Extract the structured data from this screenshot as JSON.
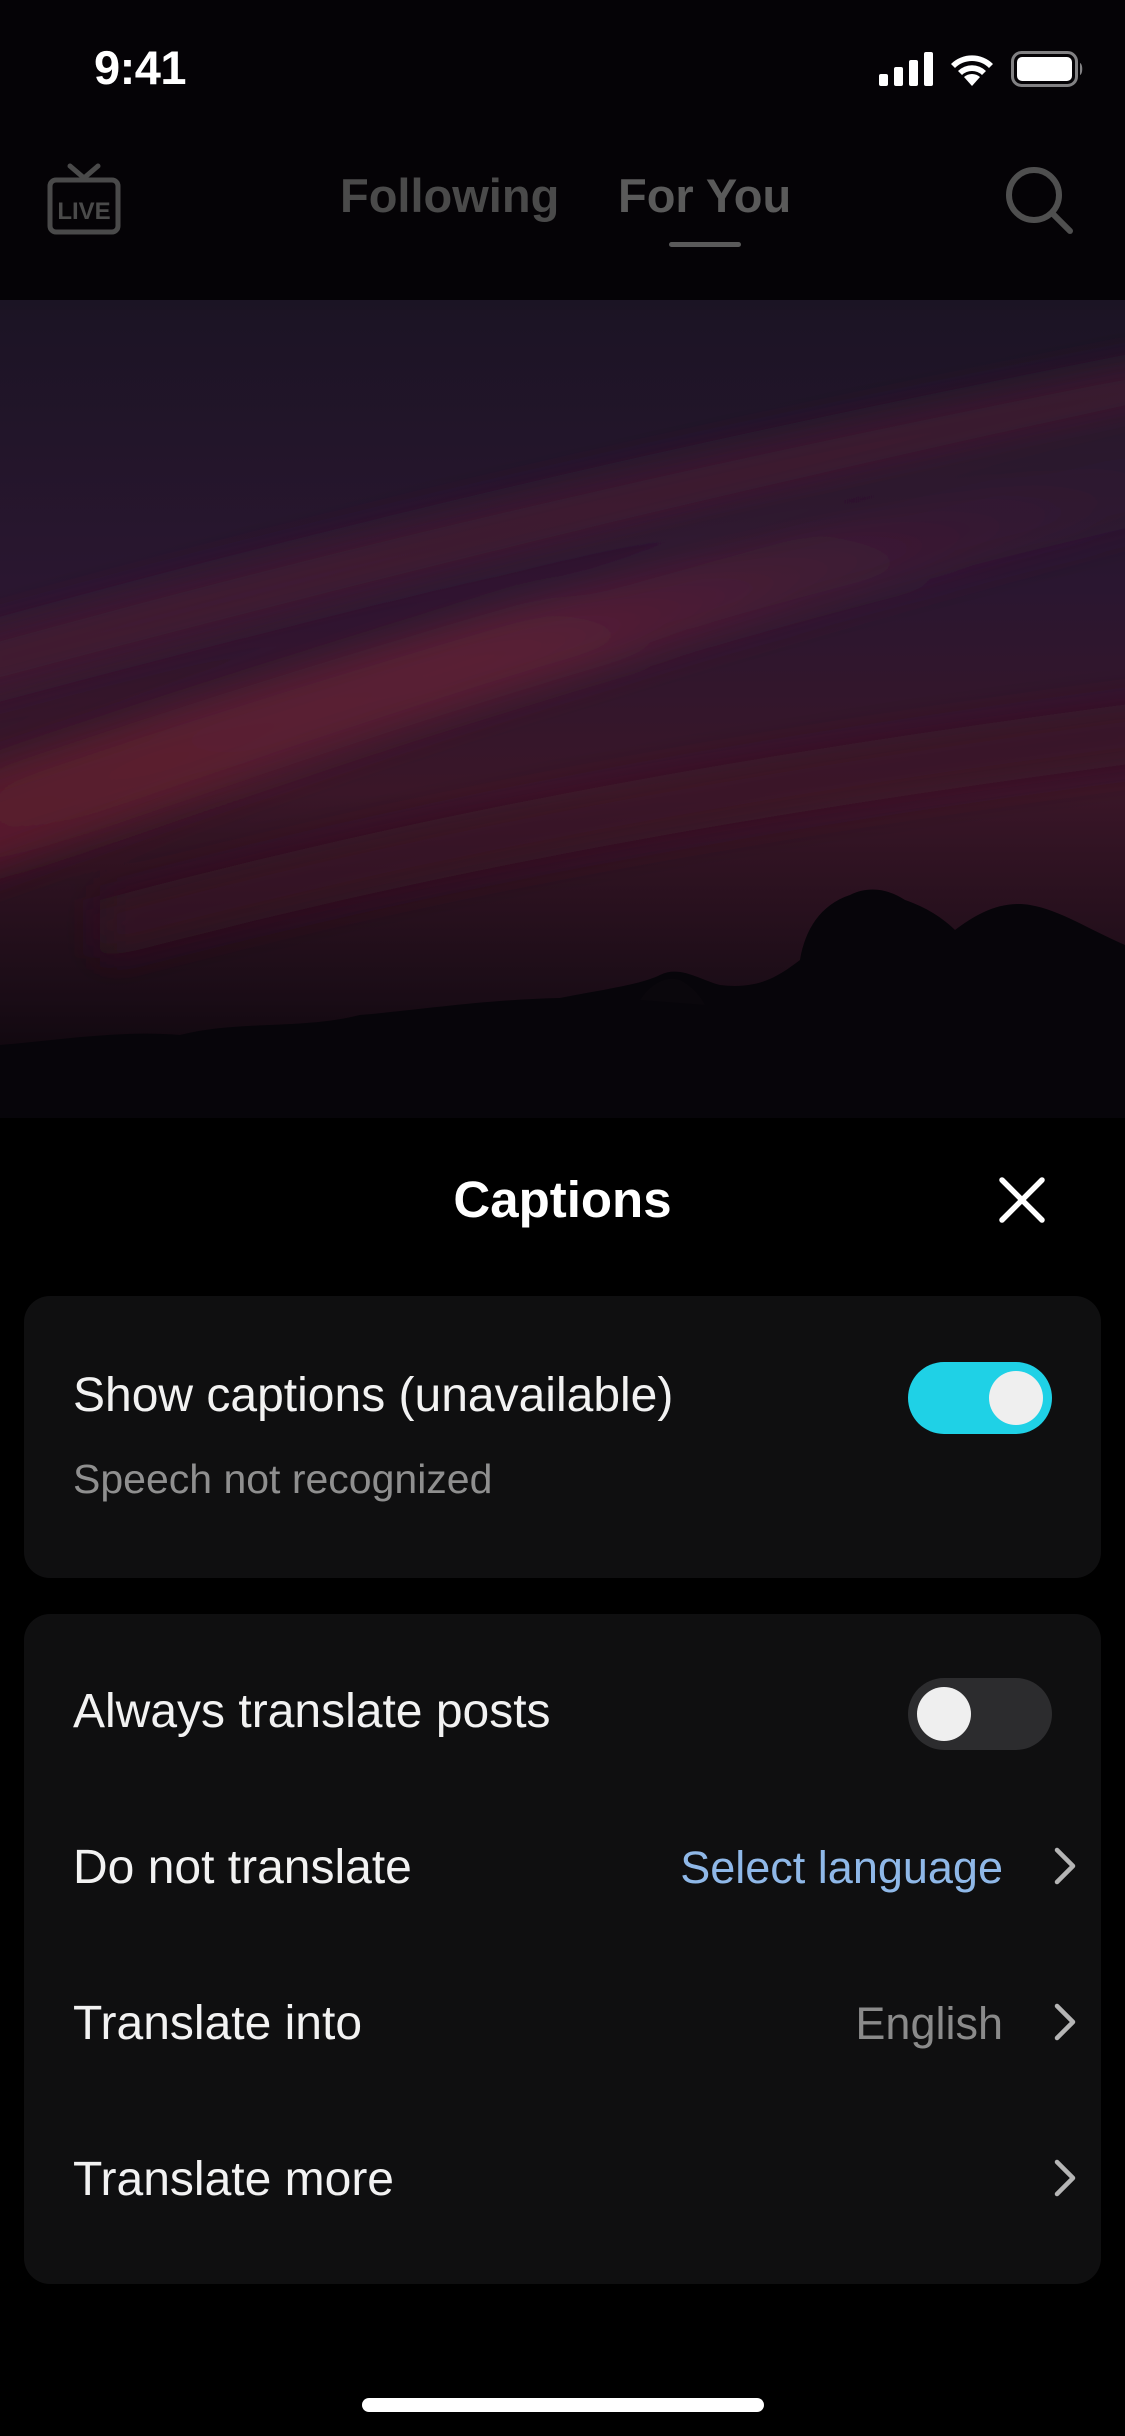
{
  "status_bar": {
    "time": "9:41"
  },
  "top_nav": {
    "live_label": "LIVE",
    "tabs": [
      {
        "label": "Following",
        "selected": false
      },
      {
        "label": "For You",
        "selected": true
      }
    ],
    "icons": [
      "live-tv-icon",
      "search-icon"
    ]
  },
  "captions_sheet": {
    "title": "Captions",
    "close_icon": "close-icon",
    "show_captions": {
      "label": "Show captions (unavailable)",
      "sublabel": "Speech not recognized",
      "enabled": true
    },
    "always_translate": {
      "label": "Always translate posts",
      "enabled": false
    },
    "do_not_translate": {
      "label": "Do not translate",
      "value": "Select language"
    },
    "translate_into": {
      "label": "Translate into",
      "value": "English"
    },
    "translate_more": {
      "label": "Translate more"
    }
  },
  "colors": {
    "toggle_on": "#1fd1e6",
    "link": "#8fb8e8",
    "card_bg": "#0f0f10"
  }
}
